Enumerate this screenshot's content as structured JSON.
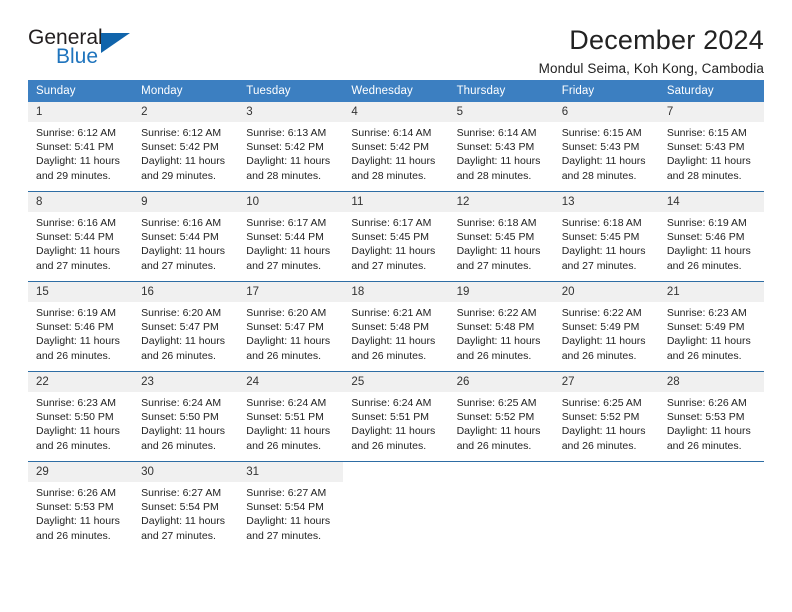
{
  "brand": {
    "name_top": "General",
    "name_bottom": "Blue",
    "color_primary": "#1064ab",
    "color_text": "#231f20"
  },
  "header": {
    "title": "December 2024",
    "subtitle": "Mondul Seima, Koh Kong, Cambodia"
  },
  "calendar": {
    "header_bg": "#3c7fc1",
    "row_divider": "#2e6da4",
    "daynum_bg": "#f0f0f0",
    "weekdays": [
      "Sunday",
      "Monday",
      "Tuesday",
      "Wednesday",
      "Thursday",
      "Friday",
      "Saturday"
    ],
    "weeks": [
      [
        {
          "day": "1",
          "sunrise": "Sunrise: 6:12 AM",
          "sunset": "Sunset: 5:41 PM",
          "daylight_1": "Daylight: 11 hours",
          "daylight_2": "and 29 minutes."
        },
        {
          "day": "2",
          "sunrise": "Sunrise: 6:12 AM",
          "sunset": "Sunset: 5:42 PM",
          "daylight_1": "Daylight: 11 hours",
          "daylight_2": "and 29 minutes."
        },
        {
          "day": "3",
          "sunrise": "Sunrise: 6:13 AM",
          "sunset": "Sunset: 5:42 PM",
          "daylight_1": "Daylight: 11 hours",
          "daylight_2": "and 28 minutes."
        },
        {
          "day": "4",
          "sunrise": "Sunrise: 6:14 AM",
          "sunset": "Sunset: 5:42 PM",
          "daylight_1": "Daylight: 11 hours",
          "daylight_2": "and 28 minutes."
        },
        {
          "day": "5",
          "sunrise": "Sunrise: 6:14 AM",
          "sunset": "Sunset: 5:43 PM",
          "daylight_1": "Daylight: 11 hours",
          "daylight_2": "and 28 minutes."
        },
        {
          "day": "6",
          "sunrise": "Sunrise: 6:15 AM",
          "sunset": "Sunset: 5:43 PM",
          "daylight_1": "Daylight: 11 hours",
          "daylight_2": "and 28 minutes."
        },
        {
          "day": "7",
          "sunrise": "Sunrise: 6:15 AM",
          "sunset": "Sunset: 5:43 PM",
          "daylight_1": "Daylight: 11 hours",
          "daylight_2": "and 28 minutes."
        }
      ],
      [
        {
          "day": "8",
          "sunrise": "Sunrise: 6:16 AM",
          "sunset": "Sunset: 5:44 PM",
          "daylight_1": "Daylight: 11 hours",
          "daylight_2": "and 27 minutes."
        },
        {
          "day": "9",
          "sunrise": "Sunrise: 6:16 AM",
          "sunset": "Sunset: 5:44 PM",
          "daylight_1": "Daylight: 11 hours",
          "daylight_2": "and 27 minutes."
        },
        {
          "day": "10",
          "sunrise": "Sunrise: 6:17 AM",
          "sunset": "Sunset: 5:44 PM",
          "daylight_1": "Daylight: 11 hours",
          "daylight_2": "and 27 minutes."
        },
        {
          "day": "11",
          "sunrise": "Sunrise: 6:17 AM",
          "sunset": "Sunset: 5:45 PM",
          "daylight_1": "Daylight: 11 hours",
          "daylight_2": "and 27 minutes."
        },
        {
          "day": "12",
          "sunrise": "Sunrise: 6:18 AM",
          "sunset": "Sunset: 5:45 PM",
          "daylight_1": "Daylight: 11 hours",
          "daylight_2": "and 27 minutes."
        },
        {
          "day": "13",
          "sunrise": "Sunrise: 6:18 AM",
          "sunset": "Sunset: 5:45 PM",
          "daylight_1": "Daylight: 11 hours",
          "daylight_2": "and 27 minutes."
        },
        {
          "day": "14",
          "sunrise": "Sunrise: 6:19 AM",
          "sunset": "Sunset: 5:46 PM",
          "daylight_1": "Daylight: 11 hours",
          "daylight_2": "and 26 minutes."
        }
      ],
      [
        {
          "day": "15",
          "sunrise": "Sunrise: 6:19 AM",
          "sunset": "Sunset: 5:46 PM",
          "daylight_1": "Daylight: 11 hours",
          "daylight_2": "and 26 minutes."
        },
        {
          "day": "16",
          "sunrise": "Sunrise: 6:20 AM",
          "sunset": "Sunset: 5:47 PM",
          "daylight_1": "Daylight: 11 hours",
          "daylight_2": "and 26 minutes."
        },
        {
          "day": "17",
          "sunrise": "Sunrise: 6:20 AM",
          "sunset": "Sunset: 5:47 PM",
          "daylight_1": "Daylight: 11 hours",
          "daylight_2": "and 26 minutes."
        },
        {
          "day": "18",
          "sunrise": "Sunrise: 6:21 AM",
          "sunset": "Sunset: 5:48 PM",
          "daylight_1": "Daylight: 11 hours",
          "daylight_2": "and 26 minutes."
        },
        {
          "day": "19",
          "sunrise": "Sunrise: 6:22 AM",
          "sunset": "Sunset: 5:48 PM",
          "daylight_1": "Daylight: 11 hours",
          "daylight_2": "and 26 minutes."
        },
        {
          "day": "20",
          "sunrise": "Sunrise: 6:22 AM",
          "sunset": "Sunset: 5:49 PM",
          "daylight_1": "Daylight: 11 hours",
          "daylight_2": "and 26 minutes."
        },
        {
          "day": "21",
          "sunrise": "Sunrise: 6:23 AM",
          "sunset": "Sunset: 5:49 PM",
          "daylight_1": "Daylight: 11 hours",
          "daylight_2": "and 26 minutes."
        }
      ],
      [
        {
          "day": "22",
          "sunrise": "Sunrise: 6:23 AM",
          "sunset": "Sunset: 5:50 PM",
          "daylight_1": "Daylight: 11 hours",
          "daylight_2": "and 26 minutes."
        },
        {
          "day": "23",
          "sunrise": "Sunrise: 6:24 AM",
          "sunset": "Sunset: 5:50 PM",
          "daylight_1": "Daylight: 11 hours",
          "daylight_2": "and 26 minutes."
        },
        {
          "day": "24",
          "sunrise": "Sunrise: 6:24 AM",
          "sunset": "Sunset: 5:51 PM",
          "daylight_1": "Daylight: 11 hours",
          "daylight_2": "and 26 minutes."
        },
        {
          "day": "25",
          "sunrise": "Sunrise: 6:24 AM",
          "sunset": "Sunset: 5:51 PM",
          "daylight_1": "Daylight: 11 hours",
          "daylight_2": "and 26 minutes."
        },
        {
          "day": "26",
          "sunrise": "Sunrise: 6:25 AM",
          "sunset": "Sunset: 5:52 PM",
          "daylight_1": "Daylight: 11 hours",
          "daylight_2": "and 26 minutes."
        },
        {
          "day": "27",
          "sunrise": "Sunrise: 6:25 AM",
          "sunset": "Sunset: 5:52 PM",
          "daylight_1": "Daylight: 11 hours",
          "daylight_2": "and 26 minutes."
        },
        {
          "day": "28",
          "sunrise": "Sunrise: 6:26 AM",
          "sunset": "Sunset: 5:53 PM",
          "daylight_1": "Daylight: 11 hours",
          "daylight_2": "and 26 minutes."
        }
      ],
      [
        {
          "day": "29",
          "sunrise": "Sunrise: 6:26 AM",
          "sunset": "Sunset: 5:53 PM",
          "daylight_1": "Daylight: 11 hours",
          "daylight_2": "and 26 minutes."
        },
        {
          "day": "30",
          "sunrise": "Sunrise: 6:27 AM",
          "sunset": "Sunset: 5:54 PM",
          "daylight_1": "Daylight: 11 hours",
          "daylight_2": "and 27 minutes."
        },
        {
          "day": "31",
          "sunrise": "Sunrise: 6:27 AM",
          "sunset": "Sunset: 5:54 PM",
          "daylight_1": "Daylight: 11 hours",
          "daylight_2": "and 27 minutes."
        },
        {
          "day": "",
          "sunrise": "",
          "sunset": "",
          "daylight_1": "",
          "daylight_2": ""
        },
        {
          "day": "",
          "sunrise": "",
          "sunset": "",
          "daylight_1": "",
          "daylight_2": ""
        },
        {
          "day": "",
          "sunrise": "",
          "sunset": "",
          "daylight_1": "",
          "daylight_2": ""
        },
        {
          "day": "",
          "sunrise": "",
          "sunset": "",
          "daylight_1": "",
          "daylight_2": ""
        }
      ]
    ]
  }
}
